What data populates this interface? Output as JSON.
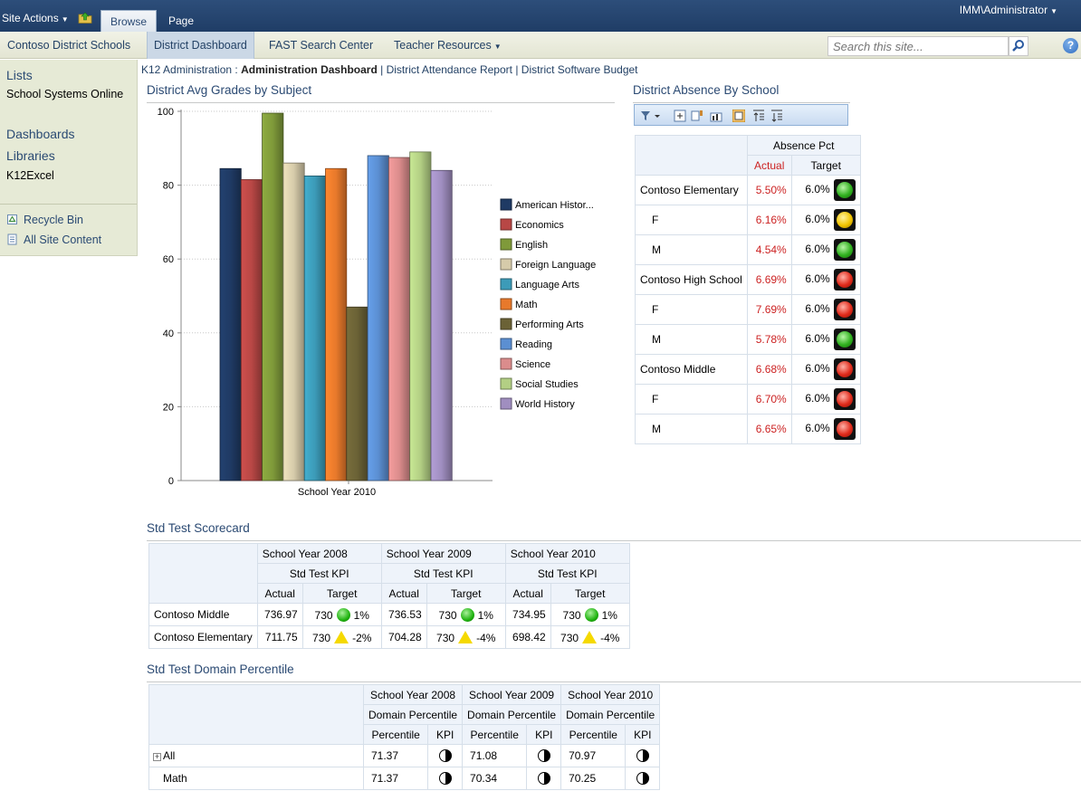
{
  "ribbon": {
    "site_actions": "Site Actions",
    "tabs": [
      "Browse",
      "Page"
    ],
    "user": "IMM\\Administrator"
  },
  "topnav": {
    "items": [
      "Contoso District Schools",
      "District Dashboard",
      "FAST Search Center",
      "Teacher Resources"
    ],
    "search_placeholder": "Search this site..."
  },
  "leftnav": {
    "lists_heading": "Lists",
    "lists_items": [
      "School Systems Online"
    ],
    "dashboards_heading": "Dashboards",
    "libraries_heading": "Libraries",
    "libraries_items": [
      "K12Excel"
    ],
    "recycle_bin": "Recycle Bin",
    "all_site_content": "All Site Content"
  },
  "breadcrumb": {
    "root": "K12 Administration",
    "separator": ":",
    "current": "Administration Dashboard",
    "links": [
      "District Attendance Report",
      "District Software Budget"
    ]
  },
  "grades_chart": {
    "title": "District Avg Grades by Subject",
    "chart_data": {
      "type": "bar",
      "categories": [
        "School Year 2010"
      ],
      "ylim": [
        0,
        100
      ],
      "yticks": [
        0,
        20,
        40,
        60,
        80,
        100
      ],
      "grid": true,
      "legend_position": "right",
      "series": [
        {
          "name": "American Histor...",
          "values": [
            84.5
          ],
          "color": "#1f3a64"
        },
        {
          "name": "Economics",
          "values": [
            81.5
          ],
          "color": "#b84745"
        },
        {
          "name": "English",
          "values": [
            99.5
          ],
          "color": "#7f9a3a"
        },
        {
          "name": "Foreign Language",
          "values": [
            86
          ],
          "color": "#d6cbaa"
        },
        {
          "name": "Language Arts",
          "values": [
            82.5
          ],
          "color": "#3c9bb8"
        },
        {
          "name": "Math",
          "values": [
            84.5
          ],
          "color": "#e8792b"
        },
        {
          "name": "Performing Arts",
          "values": [
            47
          ],
          "color": "#6b6236"
        },
        {
          "name": "Reading",
          "values": [
            88
          ],
          "color": "#5b8fd2"
        },
        {
          "name": "Science",
          "values": [
            87.5
          ],
          "color": "#db8c8c"
        },
        {
          "name": "Social Studies",
          "values": [
            89
          ],
          "color": "#b3cf84"
        },
        {
          "name": "World History",
          "values": [
            84
          ],
          "color": "#a08ec0"
        }
      ]
    }
  },
  "absence": {
    "title": "District Absence By School",
    "header_group": "Absence Pct",
    "col_actual": "Actual",
    "col_target": "Target",
    "rows": [
      {
        "label": "Contoso Elementary",
        "actual": "5.50%",
        "target": "6.0%",
        "status": "green",
        "indent": false
      },
      {
        "label": "F",
        "actual": "6.16%",
        "target": "6.0%",
        "status": "yellow",
        "indent": true
      },
      {
        "label": "M",
        "actual": "4.54%",
        "target": "6.0%",
        "status": "green",
        "indent": true
      },
      {
        "label": "Contoso High School",
        "actual": "6.69%",
        "target": "6.0%",
        "status": "red",
        "indent": false
      },
      {
        "label": "F",
        "actual": "7.69%",
        "target": "6.0%",
        "status": "red",
        "indent": true
      },
      {
        "label": "M",
        "actual": "5.78%",
        "target": "6.0%",
        "status": "green",
        "indent": true
      },
      {
        "label": "Contoso Middle",
        "actual": "6.68%",
        "target": "6.0%",
        "status": "red",
        "indent": false
      },
      {
        "label": "F",
        "actual": "6.70%",
        "target": "6.0%",
        "status": "red",
        "indent": true
      },
      {
        "label": "M",
        "actual": "6.65%",
        "target": "6.0%",
        "status": "red",
        "indent": true
      }
    ]
  },
  "scorecard": {
    "title": "Std Test Scorecard",
    "years": [
      "School Year 2008",
      "School Year 2009",
      "School Year 2010"
    ],
    "kpi": "Std Test KPI",
    "col_actual": "Actual",
    "col_target": "Target",
    "rows": [
      {
        "label": "Contoso Middle",
        "cells": [
          {
            "actual": "736.97",
            "target": "730",
            "status": "green",
            "pct": "1%"
          },
          {
            "actual": "736.53",
            "target": "730",
            "status": "green",
            "pct": "1%"
          },
          {
            "actual": "734.95",
            "target": "730",
            "status": "green",
            "pct": "1%"
          }
        ]
      },
      {
        "label": "Contoso Elementary",
        "cells": [
          {
            "actual": "711.75",
            "target": "730",
            "status": "yellow",
            "pct": "-2%"
          },
          {
            "actual": "704.28",
            "target": "730",
            "status": "yellow",
            "pct": "-4%"
          },
          {
            "actual": "698.42",
            "target": "730",
            "status": "yellow",
            "pct": "-4%"
          }
        ]
      }
    ]
  },
  "domain": {
    "title": "Std Test Domain Percentile",
    "years": [
      "School Year 2008",
      "School Year 2009",
      "School Year 2010"
    ],
    "group": "Domain Percentile",
    "col_percentile": "Percentile",
    "col_kpi": "KPI",
    "rows": [
      {
        "label": "All",
        "expandable": true,
        "values": [
          "71.37",
          "71.08",
          "70.97"
        ]
      },
      {
        "label": "Math",
        "expandable": false,
        "values": [
          "71.37",
          "70.34",
          "70.25"
        ]
      }
    ]
  }
}
